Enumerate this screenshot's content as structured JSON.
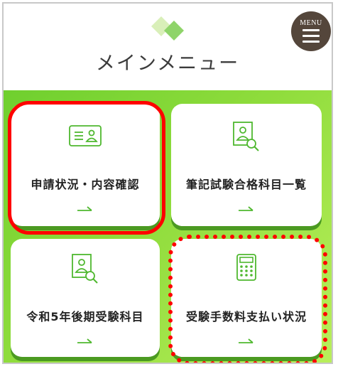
{
  "header": {
    "title": "メインメニュー",
    "menu_label": "MENU"
  },
  "cards": [
    {
      "label": "申請状況・内容確認",
      "icon": "id-card-icon"
    },
    {
      "label": "筆記試験合格科目一覧",
      "icon": "user-search-icon"
    },
    {
      "label": "令和5年後期受験科目",
      "icon": "user-search-icon"
    },
    {
      "label": "受験手数料支払い状況",
      "icon": "calculator-icon"
    }
  ],
  "colors": {
    "accent": "#4fb82f",
    "menu_button": "#54463b",
    "highlight": "#ff0000",
    "panel_start": "#6fcf2e",
    "panel_end": "#b9ef5b"
  }
}
